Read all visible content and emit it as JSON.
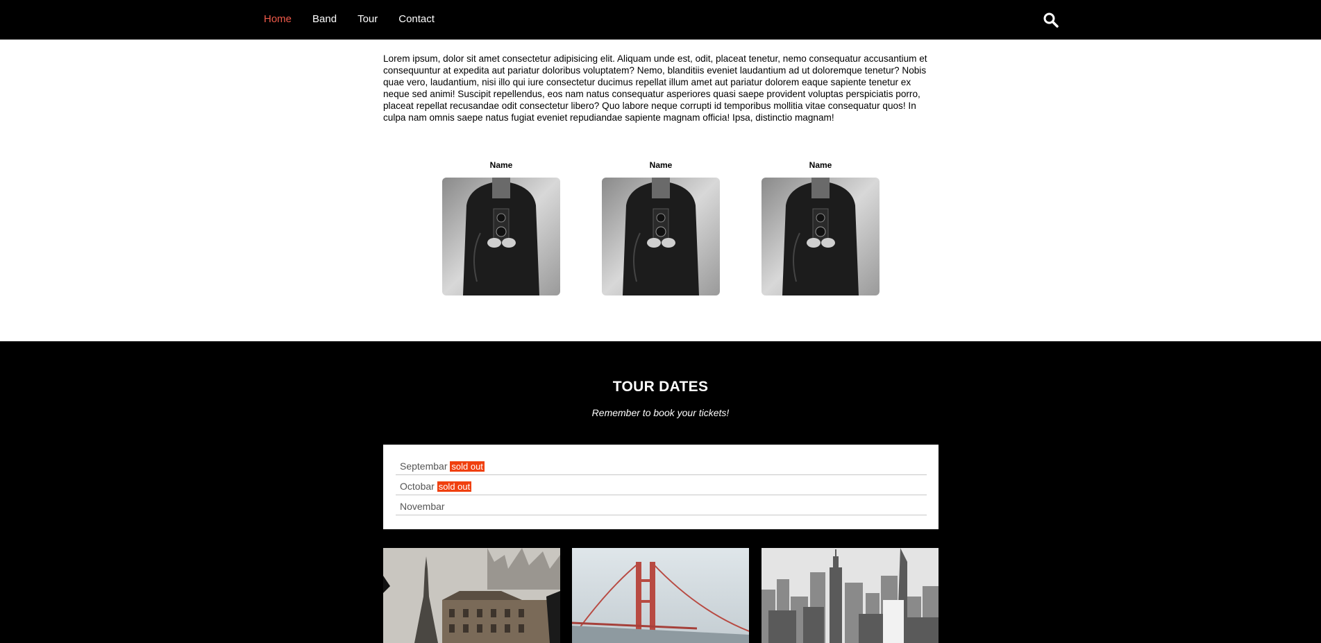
{
  "nav": {
    "links": [
      {
        "label": "Home",
        "active": true
      },
      {
        "label": "Band",
        "active": false
      },
      {
        "label": "Tour",
        "active": false
      },
      {
        "label": "Contact",
        "active": false
      }
    ],
    "search_icon": "search-icon",
    "active_color": "#f05a4a"
  },
  "intro": {
    "text": "Lorem ipsum, dolor sit amet consectetur adipisicing elit. Aliquam unde est, odit, placeat tenetur, nemo consequatur accusantium et consequuntur at expedita aut pariatur doloribus voluptatem? Nemo, blanditiis eveniet laudantium ad ut doloremque tenetur? Nobis quae vero, laudantium, nisi illo qui iure consectetur ducimus repellat illum amet aut pariatur dolorem eaque sapiente tenetur ex neque sed animi! Suscipit repellendus, eos nam natus consequatur asperiores quasi saepe provident voluptas perspiciatis porro, placeat repellat recusandae odit consectetur libero? Quo labore neque corrupti id temporibus mollitia vitae consequatur quos! In culpa nam omnis saepe natus fugiat eveniet repudiandae sapiente magnam officia! Ipsa, distinctio magnam!"
  },
  "members": [
    {
      "name": "Name"
    },
    {
      "name": "Name"
    },
    {
      "name": "Name"
    }
  ],
  "tour": {
    "title": "TOUR DATES",
    "subtitle": "Remember to book your tickets!",
    "dates": [
      {
        "month": "Septembar",
        "badge": "sold out"
      },
      {
        "month": "Octobar",
        "badge": "sold out"
      },
      {
        "month": "Novembar",
        "badge": ""
      }
    ],
    "badge_color": "#f0400f"
  }
}
